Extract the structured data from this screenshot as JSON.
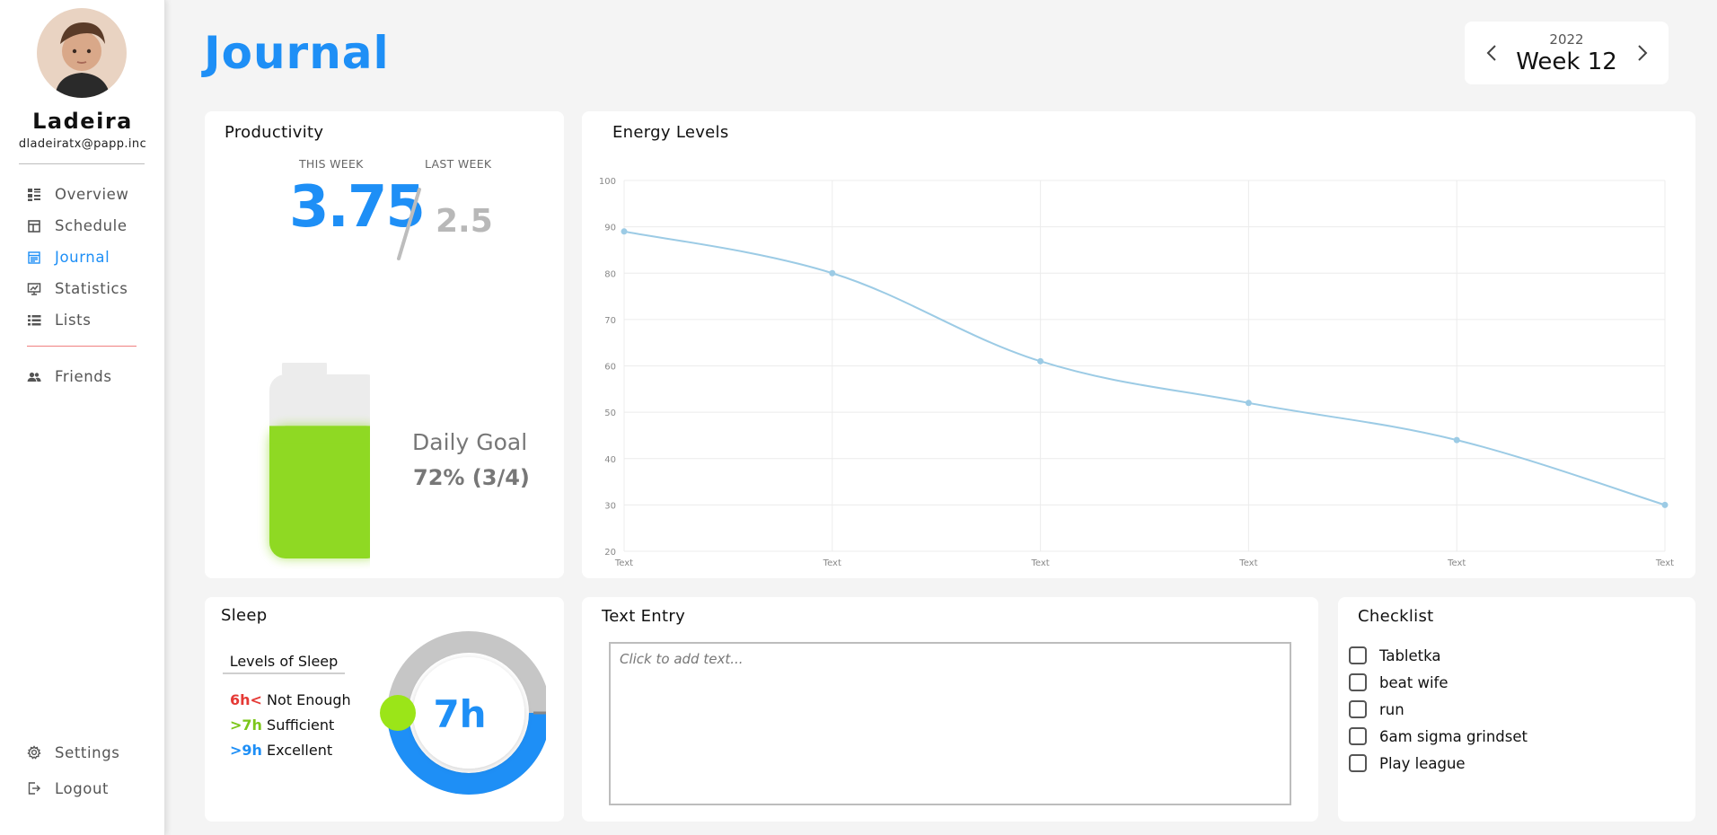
{
  "profile": {
    "name": "Ladeira",
    "email": "dladeiratx@papp.inc"
  },
  "nav": {
    "items": [
      {
        "label": "Overview",
        "icon": "overview-icon"
      },
      {
        "label": "Schedule",
        "icon": "schedule-icon"
      },
      {
        "label": "Journal",
        "icon": "journal-icon",
        "active": true
      },
      {
        "label": "Statistics",
        "icon": "statistics-icon"
      },
      {
        "label": "Lists",
        "icon": "lists-icon"
      }
    ],
    "friends": {
      "label": "Friends",
      "icon": "friends-icon"
    },
    "settings": {
      "label": "Settings",
      "icon": "gear-icon"
    },
    "logout": {
      "label": "Logout",
      "icon": "logout-icon"
    }
  },
  "header": {
    "title": "Journal",
    "year": "2022",
    "week": "Week 12"
  },
  "productivity": {
    "title": "Productivity",
    "this_week_label": "THIS WEEK",
    "last_week_label": "LAST WEEK",
    "this_week": "3.75",
    "last_week": "2.5",
    "goal_label": "Daily Goal",
    "goal_value": "72% (3/4)",
    "battery_fill": 0.72
  },
  "energy": {
    "title": "Energy Levels"
  },
  "chart_data": {
    "type": "line",
    "title": "Energy Levels",
    "x": [
      "Text",
      "Text",
      "Text",
      "Text",
      "Text",
      "Text"
    ],
    "series": [
      {
        "values": [
          89,
          80,
          61,
          52,
          44,
          30
        ]
      }
    ],
    "ylim": [
      20,
      100
    ],
    "yticks": [
      100,
      90,
      80,
      70,
      60,
      50,
      40,
      30,
      20
    ],
    "grid": true,
    "color": "#9ccbe5"
  },
  "sleep": {
    "title": "Sleep",
    "legend_title": "Levels of Sleep",
    "levels": [
      {
        "key": "6h<",
        "label": "Not Enough",
        "color": "#e53935"
      },
      {
        "key": ">7h",
        "label": "Sufficient",
        "color": "#7cc61a"
      },
      {
        "key": ">9h",
        "label": "Excellent",
        "color": "#1e8ff6"
      }
    ],
    "value": "7h",
    "fill": 0.5
  },
  "text_entry": {
    "title": "Text Entry",
    "placeholder": "Click to add text..."
  },
  "checklist": {
    "title": "Checklist",
    "items": [
      "Tabletka",
      "beat wife",
      "run",
      "6am sigma grindset",
      "Play league"
    ]
  },
  "colors": {
    "accent": "#1e8ff6",
    "battery": "#8fd923",
    "muted": "#b8b8b8"
  }
}
